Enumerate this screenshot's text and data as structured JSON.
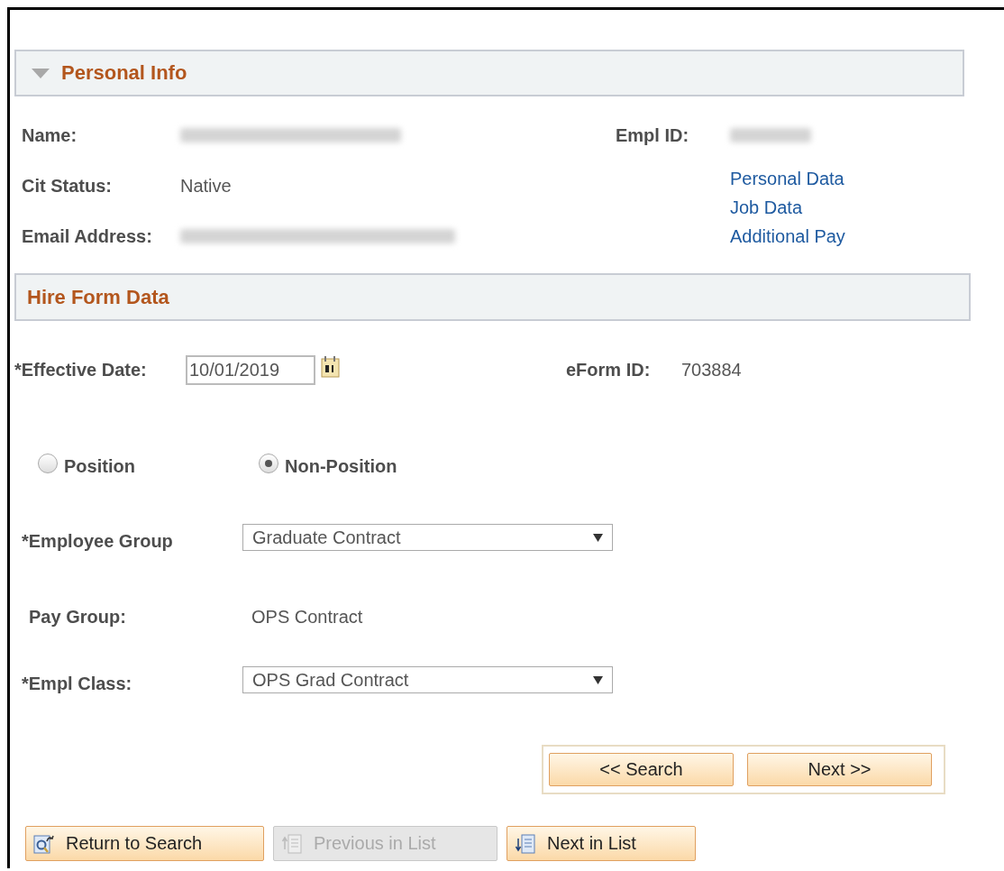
{
  "personal_info": {
    "title": "Personal Info",
    "expanded": true,
    "fields": [
      {
        "label": "Name:",
        "kind": "redacted"
      },
      {
        "label": "Cit Status:",
        "kind": "text",
        "value": "Native"
      },
      {
        "label": "Email Address:",
        "kind": "redacted"
      }
    ],
    "empl_id": {
      "label": "Empl ID:",
      "kind": "redacted"
    },
    "links": [
      "Personal Data",
      "Job Data",
      "Additional Pay"
    ]
  },
  "hire_form": {
    "title": "Hire Form Data",
    "effective_date": {
      "label": "*Effective Date:",
      "value": "10/01/2019"
    },
    "eform_id": {
      "label": "eForm ID:",
      "value": "703884"
    },
    "position_type": [
      {
        "label": "Position",
        "selected": false
      },
      {
        "label": "Non-Position",
        "selected": true
      }
    ],
    "employee_group": {
      "label": "*Employee Group",
      "value": "Graduate Contract"
    },
    "pay_group": {
      "label": "Pay Group:",
      "value": "OPS Contract"
    },
    "empl_class": {
      "label": "*Empl Class:",
      "value": "OPS Grad Contract"
    }
  },
  "nav_buttons": [
    {
      "label": "<< Search"
    },
    {
      "label": "Next >>"
    }
  ],
  "toolbar": [
    {
      "label": "Return to Search",
      "kind": "return",
      "disabled": false
    },
    {
      "label": "Previous in List",
      "kind": "previous",
      "disabled": true
    },
    {
      "label": "Next in List",
      "kind": "next",
      "disabled": false
    }
  ]
}
